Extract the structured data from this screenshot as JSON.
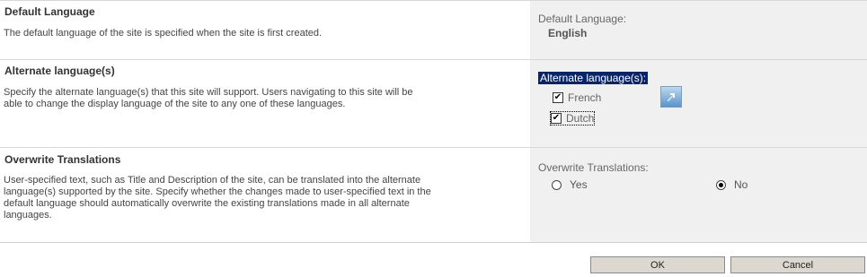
{
  "default_language": {
    "title": "Default Language",
    "description": "The default language of the site is specified when the site is first created.",
    "field_label": "Default Language:",
    "value": "English"
  },
  "alternate_languages": {
    "title": "Alternate language(s)",
    "description": "Specify the alternate language(s) that this site will support. Users navigating to this site will be able to change the display language of the site to any one of these languages.",
    "field_label": "Alternate language(s):",
    "options": [
      {
        "label": "French",
        "checked": true
      },
      {
        "label": "Dutch",
        "checked": true
      }
    ],
    "icon": "expand-arrow-icon"
  },
  "overwrite_translations": {
    "title": "Overwrite Translations",
    "description": "User-specified text, such as Title and Description of the site, can be translated into the alternate language(s) supported by the site. Specify whether the changes made to user-specified text in the default language should automatically overwrite the existing translations made in all alternate languages.",
    "field_label": "Overwrite Translations:",
    "options": [
      {
        "label": "Yes",
        "selected": false
      },
      {
        "label": "No",
        "selected": true
      }
    ]
  },
  "buttons": {
    "ok": "OK",
    "cancel": "Cancel"
  }
}
